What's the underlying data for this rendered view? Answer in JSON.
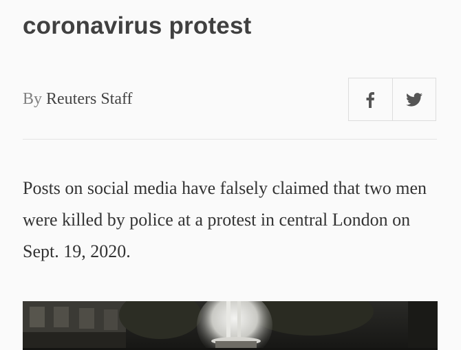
{
  "article": {
    "headline_partial": "coronavirus protest",
    "byline_prefix": "By",
    "byline_author": "Reuters Staff",
    "lead_paragraph": "Posts on social media have falsely claimed that two men were killed by police at a protest in central London on Sept. 19, 2020."
  },
  "share": {
    "buttons": [
      {
        "icon": "facebook-icon"
      },
      {
        "icon": "twitter-icon"
      }
    ]
  },
  "colors": {
    "headline": "#404040",
    "body_text": "#333333",
    "byline_prefix": "#808080",
    "share_border": "#dcdcdc",
    "icons": "#555555"
  }
}
